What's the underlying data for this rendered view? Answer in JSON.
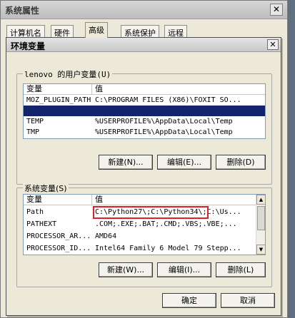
{
  "back_window": {
    "title": "系统属性",
    "close_glyph": "✕",
    "tabs": [
      "计算机名",
      "硬件",
      "高级",
      "系统保护",
      "远程"
    ]
  },
  "dialog": {
    "title": "环境变量",
    "close_glyph": "✕",
    "user_group_label": "lenovo 的用户变量(U)",
    "system_group_label": "系统变量(S)",
    "col_variable": "变量",
    "col_value": "值",
    "user_vars": [
      {
        "name": "MOZ_PLUGIN_PATH",
        "value": "C:\\PROGRAM FILES (X86)\\FOXIT SO..."
      },
      {
        "name": "",
        "value": ""
      },
      {
        "name": "TEMP",
        "value": "%USERPROFILE%\\AppData\\Local\\Temp"
      },
      {
        "name": "TMP",
        "value": "%USERPROFILE%\\AppData\\Local\\Temp"
      }
    ],
    "system_vars": [
      {
        "name": "Path",
        "value": "C:\\Python27\\;C:\\Python34\\;C:\\Us..."
      },
      {
        "name": "PATHEXT",
        "value": ".COM;.EXE;.BAT;.CMD;.VBS;.VBE;..."
      },
      {
        "name": "PROCESSOR_AR...",
        "value": "AMD64"
      },
      {
        "name": "PROCESSOR_ID...",
        "value": "Intel64 Family 6 Model 79 Stepp..."
      }
    ],
    "user_buttons": {
      "new": "新建(N)...",
      "edit": "编辑(E)...",
      "delete": "删除(D)"
    },
    "system_buttons": {
      "new": "新建(W)...",
      "edit": "编辑(I)...",
      "delete": "删除(L)"
    },
    "ok": "确定",
    "cancel": "取消"
  },
  "scroll_glyphs": {
    "up": "▲",
    "down": "▼"
  },
  "colors": {
    "selection": "#12246b",
    "highlight_box": "#e02020"
  }
}
